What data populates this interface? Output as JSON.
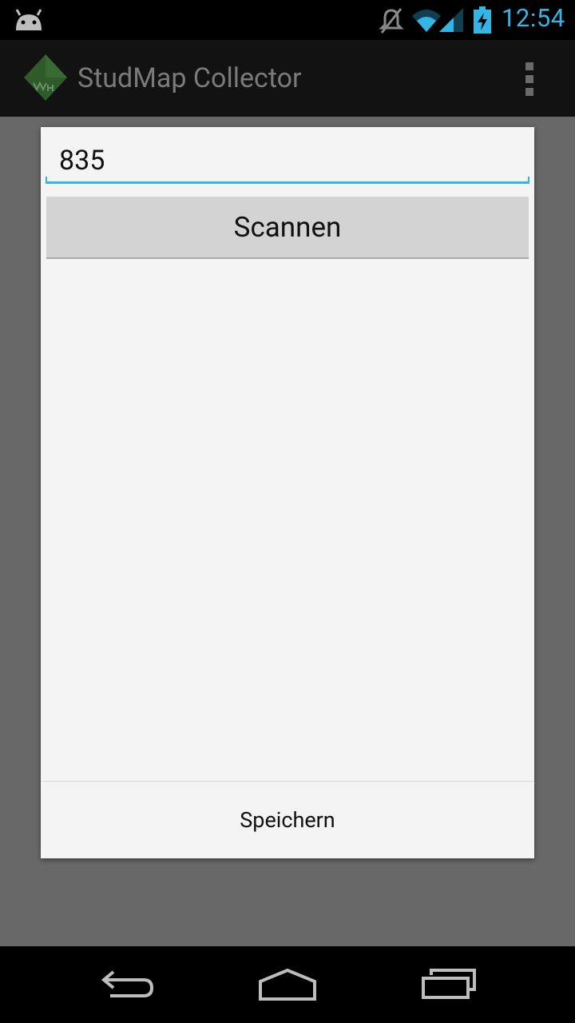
{
  "status_bar": {
    "time": "12:54",
    "icons": [
      "android-debug-icon",
      "mute-icon",
      "wifi-icon",
      "signal-icon",
      "battery-charging-icon"
    ],
    "accent_color": "#33b5e5"
  },
  "action_bar": {
    "title": "StudMap Collector",
    "logo_icon": "studmap-logo-icon",
    "overflow_icon": "overflow-menu-icon"
  },
  "dialog": {
    "input_value": "835",
    "scan_button_label": "Scannen",
    "save_button_label": "Speichern"
  },
  "nav_bar": {
    "icons": [
      "back-icon",
      "home-icon",
      "recent-apps-icon"
    ]
  }
}
